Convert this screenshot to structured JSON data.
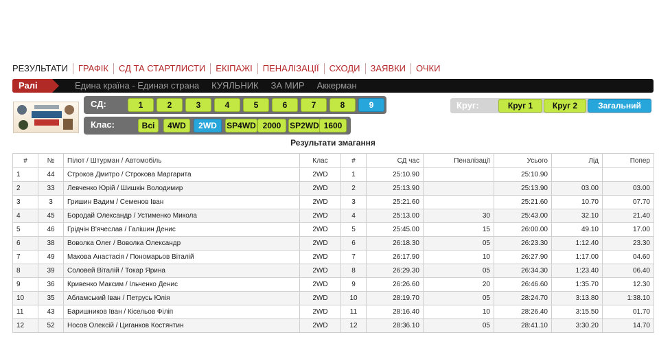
{
  "nav": {
    "items": [
      "РЕЗУЛЬТАТИ",
      "ГРАФІК",
      "СД ТА СТАРТЛИСТИ",
      "ЕКІПАЖІ",
      "ПЕНАЛІЗАЦІЇ",
      "СХОДИ",
      "ЗАЯВКИ",
      "ОЧКИ"
    ]
  },
  "rally": {
    "tag": "Ралі",
    "links": [
      "Едина країна - Единая страна",
      "КУЯЛЬНИК",
      "ЗА МИР",
      "Аккерман"
    ]
  },
  "sd": {
    "label": "СД:",
    "buttons": [
      "1",
      "2",
      "3",
      "4",
      "5",
      "6",
      "7",
      "8",
      "9"
    ],
    "active": "9"
  },
  "class_filter": {
    "label": "Клас:",
    "buttons": [
      "Всі",
      "4WD",
      "2WD",
      "SP4WD",
      "2000",
      "SP2WD",
      "1600"
    ],
    "active": "2WD"
  },
  "krug": {
    "label": "Круг:",
    "buttons": [
      "Круг 1",
      "Круг 2",
      "Загальний"
    ],
    "active": "Загальний"
  },
  "colors": {
    "accent_red": "#b5282a",
    "button_green": "#c3e844",
    "button_active_blue": "#27a6dc"
  },
  "results": {
    "title": "Результати змагання",
    "headers": [
      "#",
      "№",
      "Пілот / Штурман / Автомобіль",
      "Клас",
      "#",
      "СД час",
      "Пеналізації",
      "Усього",
      "Лід",
      "Попер"
    ],
    "rows": [
      [
        "1",
        "44",
        "Строков Дмитро / Строкова Маргарита",
        "2WD",
        "1",
        "25:10.90",
        "",
        "25:10.90",
        "",
        ""
      ],
      [
        "2",
        "33",
        "Левченко Юрій / Шишкін Володимир",
        "2WD",
        "2",
        "25:13.90",
        "",
        "25:13.90",
        "03.00",
        "03.00"
      ],
      [
        "3",
        "3",
        "Гришин Вадим / Семенов Іван",
        "2WD",
        "3",
        "25:21.60",
        "",
        "25:21.60",
        "10.70",
        "07.70"
      ],
      [
        "4",
        "45",
        "Бородай Олександр / Устименко Микола",
        "2WD",
        "4",
        "25:13.00",
        "30",
        "25:43.00",
        "32.10",
        "21.40"
      ],
      [
        "5",
        "46",
        "Грідчін В'ячеслав / Галішин Денис",
        "2WD",
        "5",
        "25:45.00",
        "15",
        "26:00.00",
        "49.10",
        "17.00"
      ],
      [
        "6",
        "38",
        "Воволка Олег / Воволка Олександр",
        "2WD",
        "6",
        "26:18.30",
        "05",
        "26:23.30",
        "1:12.40",
        "23.30"
      ],
      [
        "7",
        "49",
        "Макова Анастасія / Пономарьов Віталій",
        "2WD",
        "7",
        "26:17.90",
        "10",
        "26:27.90",
        "1:17.00",
        "04.60"
      ],
      [
        "8",
        "39",
        "Соловей Віталій / Токар Ярина",
        "2WD",
        "8",
        "26:29.30",
        "05",
        "26:34.30",
        "1:23.40",
        "06.40"
      ],
      [
        "9",
        "36",
        "Кривенко Максим / Ільченко Денис",
        "2WD",
        "9",
        "26:26.60",
        "20",
        "26:46.60",
        "1:35.70",
        "12.30"
      ],
      [
        "10",
        "35",
        "Абламський Іван / Петрусь Юлія",
        "2WD",
        "10",
        "28:19.70",
        "05",
        "28:24.70",
        "3:13.80",
        "1:38.10"
      ],
      [
        "11",
        "43",
        "Баришников Іван / Кісельов Філіп",
        "2WD",
        "11",
        "28:16.40",
        "10",
        "28:26.40",
        "3:15.50",
        "01.70"
      ],
      [
        "12",
        "52",
        "Носов Олексій / Циганков Костянтин",
        "2WD",
        "12",
        "28:36.10",
        "05",
        "28:41.10",
        "3:30.20",
        "14.70"
      ]
    ]
  }
}
